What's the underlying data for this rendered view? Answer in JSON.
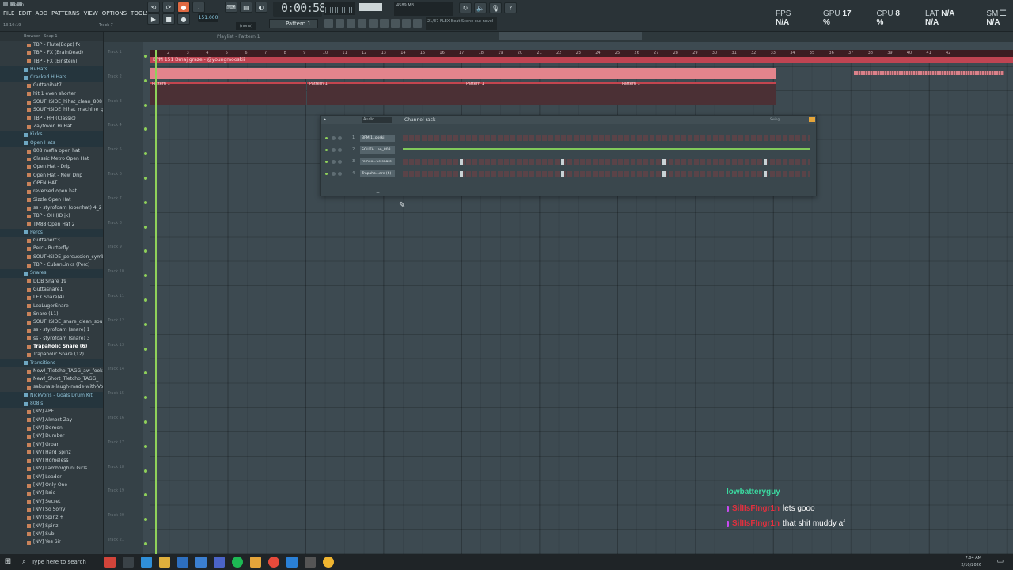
{
  "titlebar": {
    "project": "Kevin"
  },
  "menu": [
    "FILE",
    "EDIT",
    "ADD",
    "PATTERNS",
    "VIEW",
    "OPTIONS",
    "TOOLS",
    "?"
  ],
  "hint_time": "13:10:19",
  "track_hint": "Track 7",
  "transport": {
    "bpm": "151.000",
    "time": "0:00:58",
    "pattern": "Pattern 1",
    "snap": "(none)"
  },
  "cpu_mini": {
    "mem": "4589 MB",
    "count": "2"
  },
  "hintbar": "21/37 FLEX Beat Scene out novel",
  "stats": {
    "fps_label": "FPS",
    "fps": "N/A",
    "gpu_label": "GPU",
    "gpu": "17 %",
    "cpu_label": "CPU",
    "cpu": "8 %",
    "lat_label": "LAT",
    "lat1": "N/A",
    "lat2": "N/A",
    "sm_label": "SM",
    "sm": "N/A"
  },
  "browser": {
    "header": "Browser - Snap 1",
    "items": [
      {
        "t": "TBP - Flute(Bopz) fx",
        "k": "file"
      },
      {
        "t": "TBP - FX (BrainDead)",
        "k": "file"
      },
      {
        "t": "TBP - FX (Einstein)",
        "k": "file"
      },
      {
        "t": "Hi-Hats",
        "k": "folder"
      },
      {
        "t": "Cracked HiHats",
        "k": "folder"
      },
      {
        "t": "Guttahihat7",
        "k": "file"
      },
      {
        "t": "hit 1 even shorter",
        "k": "file"
      },
      {
        "t": "SOUTHSIDE_hihat_clean_808",
        "k": "file"
      },
      {
        "t": "SOUTHSIDE_hihat_machine_gun",
        "k": "file"
      },
      {
        "t": "TBP - HH (Classic)",
        "k": "file"
      },
      {
        "t": "Zaytoven Hi Hat",
        "k": "file"
      },
      {
        "t": "Kicks",
        "k": "folder"
      },
      {
        "t": "Open Hats",
        "k": "folder"
      },
      {
        "t": "808 mafia open hat",
        "k": "file"
      },
      {
        "t": "Classic Metro Open Hat",
        "k": "file"
      },
      {
        "t": "Open Hat - Drip",
        "k": "file"
      },
      {
        "t": "Open Hat - New Drip",
        "k": "file"
      },
      {
        "t": "OPEN HAT",
        "k": "file"
      },
      {
        "t": "reversed open hat",
        "k": "file"
      },
      {
        "t": "Sizzle Open Hat",
        "k": "file"
      },
      {
        "t": "ss - styrofoam (openhat) 4_2",
        "k": "file"
      },
      {
        "t": "TBP - OH (ID jk)",
        "k": "file"
      },
      {
        "t": "TM88 Open Hat 2",
        "k": "file"
      },
      {
        "t": "Percs",
        "k": "folder"
      },
      {
        "t": "Guttaperc3",
        "k": "file"
      },
      {
        "t": "Perc - Butterfly",
        "k": "file"
      },
      {
        "t": "SOUTHSIDE_percussion_cymbrewy",
        "k": "file"
      },
      {
        "t": "TBP - CubanLinks (Perc)",
        "k": "file"
      },
      {
        "t": "Snares",
        "k": "folder"
      },
      {
        "t": "DDB Snare 19",
        "k": "file"
      },
      {
        "t": "Guttasnare1",
        "k": "file"
      },
      {
        "t": "LEX Snare(4)",
        "k": "file"
      },
      {
        "t": "LexLugerSnare",
        "k": "file"
      },
      {
        "t": "Snare (11)",
        "k": "file"
      },
      {
        "t": "SOUTHSIDE_snare_clean_soul",
        "k": "file"
      },
      {
        "t": "ss - styrofoam (snare) 1",
        "k": "file"
      },
      {
        "t": "ss - styrofoam (snare) 3",
        "k": "file"
      },
      {
        "t": "Trapaholic Snare (6)",
        "k": "file hl"
      },
      {
        "t": "Trapaholic Snare (12)",
        "k": "file"
      },
      {
        "t": "Transitions",
        "k": "folder"
      },
      {
        "t": "New!_Tletcho_TAGG_aw_fookin_got_em",
        "k": "file"
      },
      {
        "t": "New!_Short_Tletcho_TAGG_",
        "k": "file"
      },
      {
        "t": "sakuna's-laugh-made-with-Voicemod",
        "k": "file"
      },
      {
        "t": "NickVoris - Goals Drum Kit",
        "k": "folder"
      },
      {
        "t": "808's",
        "k": "folder"
      },
      {
        "t": "[NV] 4PF",
        "k": "file"
      },
      {
        "t": "[NV] Almost Zay",
        "k": "file"
      },
      {
        "t": "[NV] Demon",
        "k": "file"
      },
      {
        "t": "[NV] Dumber",
        "k": "file"
      },
      {
        "t": "[NV] Groan",
        "k": "file"
      },
      {
        "t": "[NV] Hard Spinz",
        "k": "file"
      },
      {
        "t": "[NV] Homeless",
        "k": "file"
      },
      {
        "t": "[NV] Lamborghini Girls",
        "k": "file"
      },
      {
        "t": "[NV] Leader",
        "k": "file"
      },
      {
        "t": "[NV] Only One",
        "k": "file"
      },
      {
        "t": "[NV] Raid",
        "k": "file"
      },
      {
        "t": "[NV] Secret",
        "k": "file"
      },
      {
        "t": "[NV] So Sorry",
        "k": "file"
      },
      {
        "t": "[NV] Spinz +",
        "k": "file"
      },
      {
        "t": "[NV] Spinz",
        "k": "file"
      },
      {
        "t": "[NV] Sub",
        "k": "file"
      },
      {
        "t": "[NV] Yes Sir",
        "k": "file"
      }
    ]
  },
  "playlist": {
    "title": "Playlist - Pattern 1",
    "ruler": [
      "2",
      "3",
      "4",
      "5",
      "6",
      "7",
      "8",
      "9",
      "10",
      "11",
      "12",
      "13",
      "14",
      "15",
      "16",
      "17",
      "18",
      "19",
      "20",
      "21",
      "22",
      "23",
      "24",
      "25",
      "26",
      "27",
      "28",
      "29",
      "30",
      "31",
      "32",
      "33",
      "34",
      "35",
      "36",
      "37",
      "38",
      "39",
      "40",
      "41",
      "42"
    ],
    "audio_clip": "BPM 151 Dmaj graze - @youngmooskii",
    "patterns": [
      "Pattern 1",
      "Pattern 1",
      "Pattern 1",
      "Pattern 1"
    ],
    "tracks": [
      "Track 1",
      "Track 2",
      "Track 3",
      "Track 4",
      "Track 5",
      "Track 6",
      "Track 7",
      "Track 8",
      "Track 9",
      "Track 10",
      "Track 11",
      "Track 12",
      "Track 13",
      "Track 14",
      "Track 15",
      "Track 16",
      "Track 17",
      "Track 18",
      "Track 19",
      "Track 20",
      "Track 21",
      "Track 22"
    ]
  },
  "channel_rack": {
    "title": "Channel rack",
    "audio_label": "Audio",
    "swing": "Swing",
    "channels": [
      {
        "num": "1",
        "name": "BPM 1..ooski"
      },
      {
        "num": "2",
        "name": "SOUTH...an_808"
      },
      {
        "num": "3",
        "name": "remex...ve snare"
      },
      {
        "num": "4",
        "name": "Trapaho...are (6)"
      }
    ],
    "add": "+"
  },
  "chat": {
    "user1": "lowbatteryguy",
    "msgs": [
      {
        "user": "SilIIsFIngr1n",
        "text": "lets gooo"
      },
      {
        "user": "SilIIsFIngr1n",
        "text": "that shit muddy af"
      }
    ]
  },
  "taskbar": {
    "search": "Type here to search",
    "time": "7:04 AM",
    "date": "2/10/2026"
  }
}
